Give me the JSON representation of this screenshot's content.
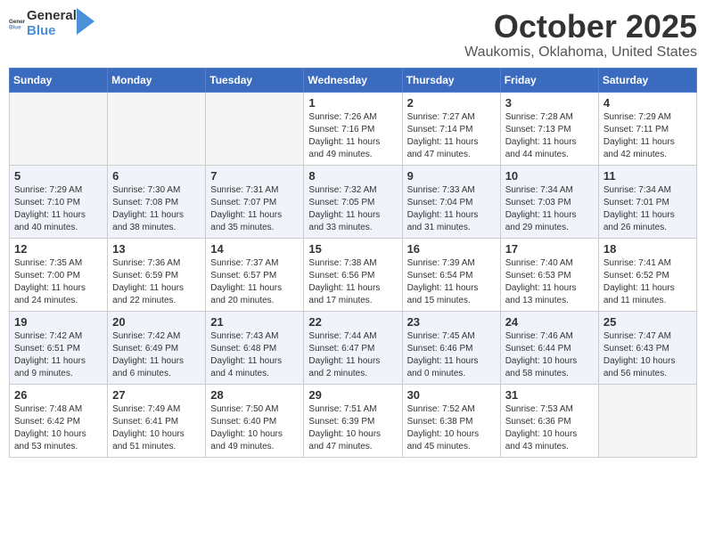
{
  "header": {
    "logo_general": "General",
    "logo_blue": "Blue",
    "month": "October 2025",
    "location": "Waukomis, Oklahoma, United States"
  },
  "weekdays": [
    "Sunday",
    "Monday",
    "Tuesday",
    "Wednesday",
    "Thursday",
    "Friday",
    "Saturday"
  ],
  "weeks": [
    [
      {
        "day": "",
        "info": ""
      },
      {
        "day": "",
        "info": ""
      },
      {
        "day": "",
        "info": ""
      },
      {
        "day": "1",
        "info": "Sunrise: 7:26 AM\nSunset: 7:16 PM\nDaylight: 11 hours\nand 49 minutes."
      },
      {
        "day": "2",
        "info": "Sunrise: 7:27 AM\nSunset: 7:14 PM\nDaylight: 11 hours\nand 47 minutes."
      },
      {
        "day": "3",
        "info": "Sunrise: 7:28 AM\nSunset: 7:13 PM\nDaylight: 11 hours\nand 44 minutes."
      },
      {
        "day": "4",
        "info": "Sunrise: 7:29 AM\nSunset: 7:11 PM\nDaylight: 11 hours\nand 42 minutes."
      }
    ],
    [
      {
        "day": "5",
        "info": "Sunrise: 7:29 AM\nSunset: 7:10 PM\nDaylight: 11 hours\nand 40 minutes."
      },
      {
        "day": "6",
        "info": "Sunrise: 7:30 AM\nSunset: 7:08 PM\nDaylight: 11 hours\nand 38 minutes."
      },
      {
        "day": "7",
        "info": "Sunrise: 7:31 AM\nSunset: 7:07 PM\nDaylight: 11 hours\nand 35 minutes."
      },
      {
        "day": "8",
        "info": "Sunrise: 7:32 AM\nSunset: 7:05 PM\nDaylight: 11 hours\nand 33 minutes."
      },
      {
        "day": "9",
        "info": "Sunrise: 7:33 AM\nSunset: 7:04 PM\nDaylight: 11 hours\nand 31 minutes."
      },
      {
        "day": "10",
        "info": "Sunrise: 7:34 AM\nSunset: 7:03 PM\nDaylight: 11 hours\nand 29 minutes."
      },
      {
        "day": "11",
        "info": "Sunrise: 7:34 AM\nSunset: 7:01 PM\nDaylight: 11 hours\nand 26 minutes."
      }
    ],
    [
      {
        "day": "12",
        "info": "Sunrise: 7:35 AM\nSunset: 7:00 PM\nDaylight: 11 hours\nand 24 minutes."
      },
      {
        "day": "13",
        "info": "Sunrise: 7:36 AM\nSunset: 6:59 PM\nDaylight: 11 hours\nand 22 minutes."
      },
      {
        "day": "14",
        "info": "Sunrise: 7:37 AM\nSunset: 6:57 PM\nDaylight: 11 hours\nand 20 minutes."
      },
      {
        "day": "15",
        "info": "Sunrise: 7:38 AM\nSunset: 6:56 PM\nDaylight: 11 hours\nand 17 minutes."
      },
      {
        "day": "16",
        "info": "Sunrise: 7:39 AM\nSunset: 6:54 PM\nDaylight: 11 hours\nand 15 minutes."
      },
      {
        "day": "17",
        "info": "Sunrise: 7:40 AM\nSunset: 6:53 PM\nDaylight: 11 hours\nand 13 minutes."
      },
      {
        "day": "18",
        "info": "Sunrise: 7:41 AM\nSunset: 6:52 PM\nDaylight: 11 hours\nand 11 minutes."
      }
    ],
    [
      {
        "day": "19",
        "info": "Sunrise: 7:42 AM\nSunset: 6:51 PM\nDaylight: 11 hours\nand 9 minutes."
      },
      {
        "day": "20",
        "info": "Sunrise: 7:42 AM\nSunset: 6:49 PM\nDaylight: 11 hours\nand 6 minutes."
      },
      {
        "day": "21",
        "info": "Sunrise: 7:43 AM\nSunset: 6:48 PM\nDaylight: 11 hours\nand 4 minutes."
      },
      {
        "day": "22",
        "info": "Sunrise: 7:44 AM\nSunset: 6:47 PM\nDaylight: 11 hours\nand 2 minutes."
      },
      {
        "day": "23",
        "info": "Sunrise: 7:45 AM\nSunset: 6:46 PM\nDaylight: 11 hours\nand 0 minutes."
      },
      {
        "day": "24",
        "info": "Sunrise: 7:46 AM\nSunset: 6:44 PM\nDaylight: 10 hours\nand 58 minutes."
      },
      {
        "day": "25",
        "info": "Sunrise: 7:47 AM\nSunset: 6:43 PM\nDaylight: 10 hours\nand 56 minutes."
      }
    ],
    [
      {
        "day": "26",
        "info": "Sunrise: 7:48 AM\nSunset: 6:42 PM\nDaylight: 10 hours\nand 53 minutes."
      },
      {
        "day": "27",
        "info": "Sunrise: 7:49 AM\nSunset: 6:41 PM\nDaylight: 10 hours\nand 51 minutes."
      },
      {
        "day": "28",
        "info": "Sunrise: 7:50 AM\nSunset: 6:40 PM\nDaylight: 10 hours\nand 49 minutes."
      },
      {
        "day": "29",
        "info": "Sunrise: 7:51 AM\nSunset: 6:39 PM\nDaylight: 10 hours\nand 47 minutes."
      },
      {
        "day": "30",
        "info": "Sunrise: 7:52 AM\nSunset: 6:38 PM\nDaylight: 10 hours\nand 45 minutes."
      },
      {
        "day": "31",
        "info": "Sunrise: 7:53 AM\nSunset: 6:36 PM\nDaylight: 10 hours\nand 43 minutes."
      },
      {
        "day": "",
        "info": ""
      }
    ]
  ]
}
